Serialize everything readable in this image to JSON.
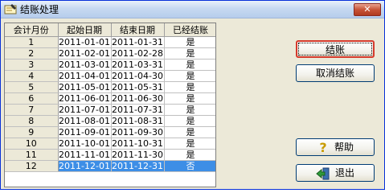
{
  "window": {
    "title": "结账处理",
    "close_glyph": "✕"
  },
  "grid": {
    "columns": [
      "会计月份",
      "起始日期",
      "结束日期",
      "已经结账"
    ],
    "rows": [
      {
        "month": "1",
        "start": "2011-01-01",
        "end": "2011-01-31",
        "closed": "是"
      },
      {
        "month": "2",
        "start": "2011-02-01",
        "end": "2011-02-28",
        "closed": "是"
      },
      {
        "month": "3",
        "start": "2011-03-01",
        "end": "2011-03-31",
        "closed": "是"
      },
      {
        "month": "4",
        "start": "2011-04-01",
        "end": "2011-04-30",
        "closed": "是"
      },
      {
        "month": "5",
        "start": "2011-05-01",
        "end": "2011-05-31",
        "closed": "是"
      },
      {
        "month": "6",
        "start": "2011-06-01",
        "end": "2011-06-30",
        "closed": "是"
      },
      {
        "month": "7",
        "start": "2011-07-01",
        "end": "2011-07-31",
        "closed": "是"
      },
      {
        "month": "8",
        "start": "2011-08-01",
        "end": "2011-08-31",
        "closed": "是"
      },
      {
        "month": "9",
        "start": "2011-09-01",
        "end": "2011-09-30",
        "closed": "是"
      },
      {
        "month": "10",
        "start": "2011-10-01",
        "end": "2011-10-31",
        "closed": "是"
      },
      {
        "month": "11",
        "start": "2011-11-01",
        "end": "2011-11-30",
        "closed": "是"
      },
      {
        "month": "12",
        "start": "2011-12-01",
        "end": "2011-12-31",
        "closed": "否"
      }
    ],
    "selected_row": 11
  },
  "buttons": {
    "close_books": "结账",
    "cancel_close": "取消结账",
    "help": "帮助",
    "exit": "退出"
  },
  "colors": {
    "selection": "#3d8ee6",
    "focus_border": "#d53a2c",
    "help_icon": "#c89b00"
  }
}
